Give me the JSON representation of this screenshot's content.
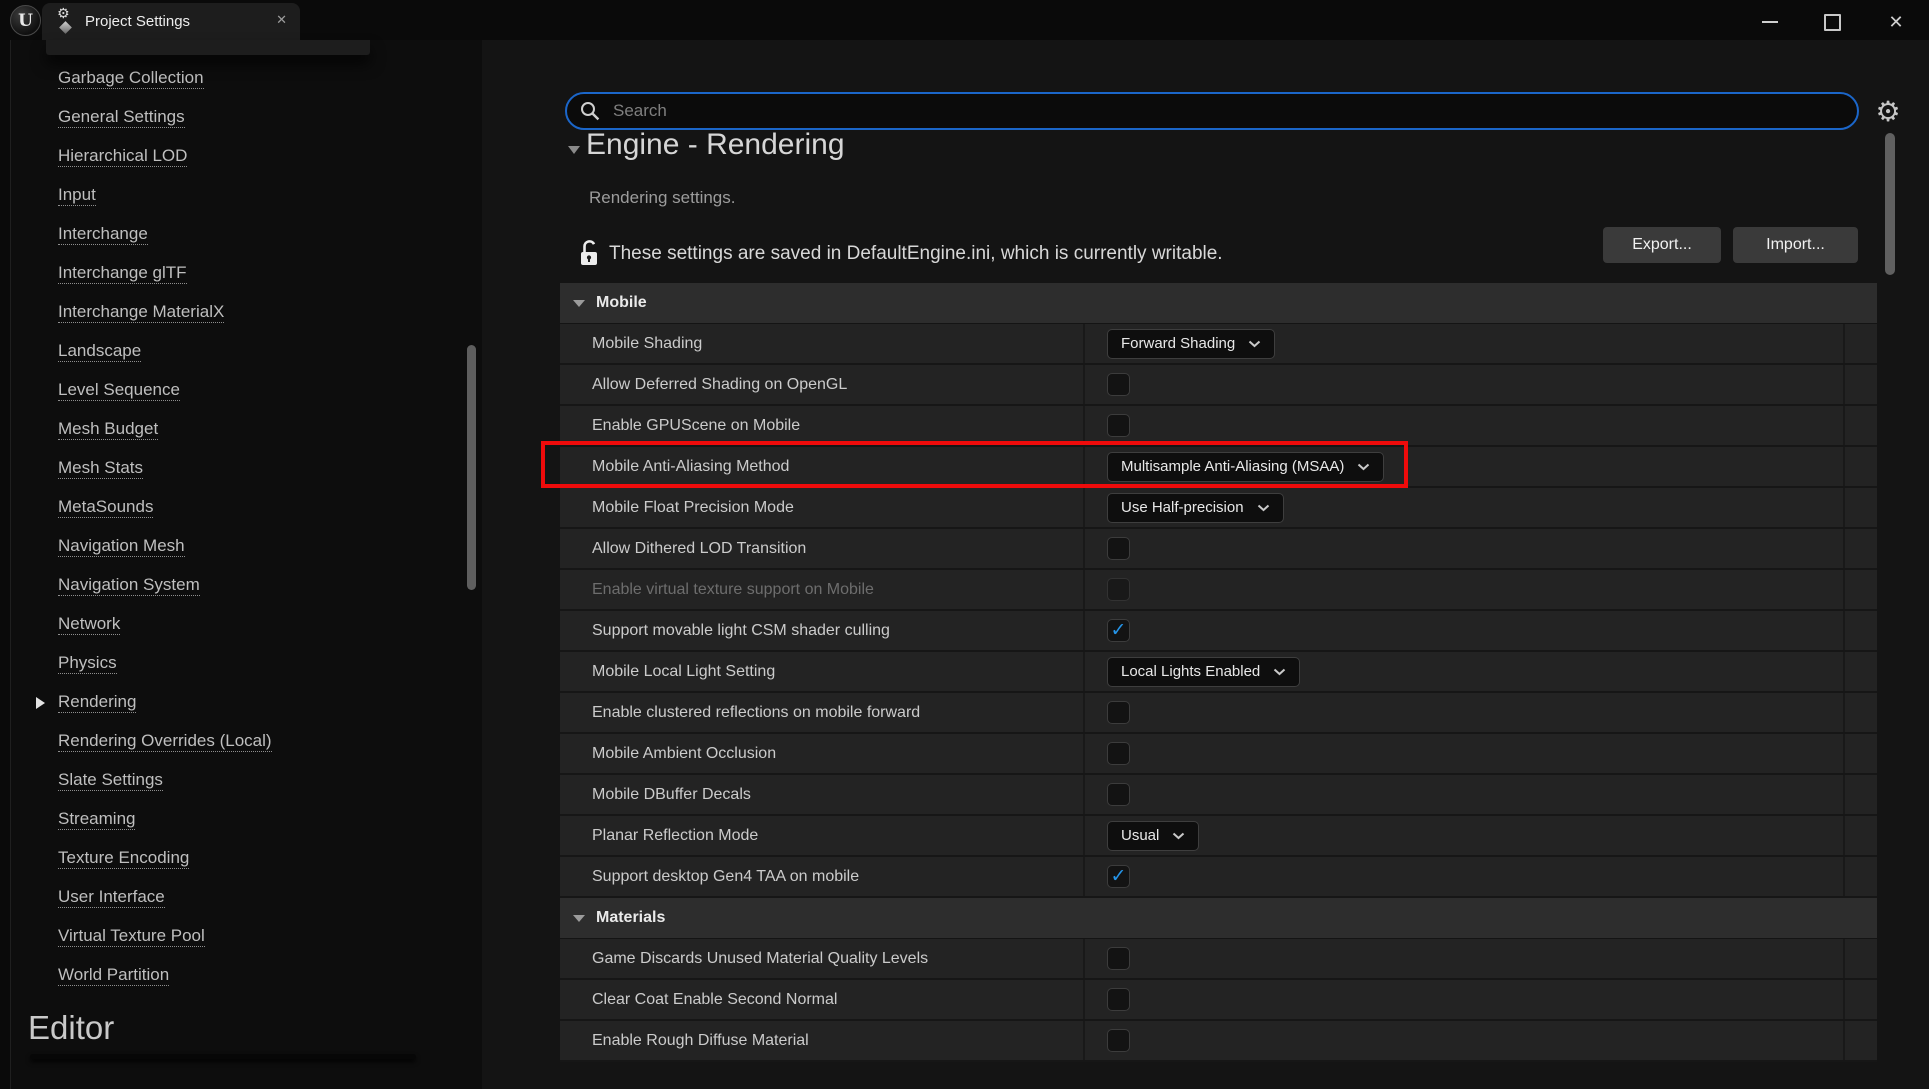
{
  "titlebar": {
    "tab": {
      "label": "Project Settings",
      "close_glyph": "✕"
    },
    "logo_letter": "U",
    "window_controls": {
      "close_glyph": "✕"
    }
  },
  "sidebar": {
    "items": [
      {
        "label": "Garbage Collection"
      },
      {
        "label": "General Settings"
      },
      {
        "label": "Hierarchical LOD"
      },
      {
        "label": "Input"
      },
      {
        "label": "Interchange"
      },
      {
        "label": "Interchange glTF"
      },
      {
        "label": "Interchange MaterialX"
      },
      {
        "label": "Landscape"
      },
      {
        "label": "Level Sequence"
      },
      {
        "label": "Mesh Budget"
      },
      {
        "label": "Mesh Stats"
      },
      {
        "label": "MetaSounds"
      },
      {
        "label": "Navigation Mesh"
      },
      {
        "label": "Navigation System"
      },
      {
        "label": "Network"
      },
      {
        "label": "Physics"
      },
      {
        "label": "Rendering",
        "selected": true
      },
      {
        "label": "Rendering Overrides (Local)"
      },
      {
        "label": "Slate Settings"
      },
      {
        "label": "Streaming"
      },
      {
        "label": "Texture Encoding"
      },
      {
        "label": "User Interface"
      },
      {
        "label": "Virtual Texture Pool"
      },
      {
        "label": "World Partition"
      }
    ],
    "footer_section": "Editor"
  },
  "search": {
    "placeholder": "Search"
  },
  "page": {
    "title": "Engine - Rendering",
    "subtitle": "Rendering settings.",
    "notice": "These settings are saved in DefaultEngine.ini, which is currently writable.",
    "export_button": "Export...",
    "import_button": "Import...",
    "gear_glyph": "⚙"
  },
  "sections": [
    {
      "label": "Mobile",
      "rows": [
        {
          "label": "Mobile Shading",
          "control": "dropdown",
          "value": "Forward Shading"
        },
        {
          "label": "Allow Deferred Shading on OpenGL",
          "control": "checkbox",
          "checked": false
        },
        {
          "label": "Enable GPUScene on Mobile",
          "control": "checkbox",
          "checked": false
        },
        {
          "label": "Mobile Anti-Aliasing Method",
          "control": "dropdown",
          "value": "Multisample Anti-Aliasing (MSAA)",
          "highlighted": true
        },
        {
          "label": "Mobile Float Precision Mode",
          "control": "dropdown",
          "value": "Use Half-precision"
        },
        {
          "label": "Allow Dithered LOD Transition",
          "control": "checkbox",
          "checked": false
        },
        {
          "label": "Enable virtual texture support on Mobile",
          "control": "checkbox",
          "checked": false,
          "disabled": true
        },
        {
          "label": "Support movable light CSM shader culling",
          "control": "checkbox",
          "checked": true
        },
        {
          "label": "Mobile Local Light Setting",
          "control": "dropdown",
          "value": "Local Lights Enabled"
        },
        {
          "label": "Enable clustered reflections on mobile forward",
          "control": "checkbox",
          "checked": false
        },
        {
          "label": "Mobile Ambient Occlusion",
          "control": "checkbox",
          "checked": false
        },
        {
          "label": "Mobile DBuffer Decals",
          "control": "checkbox",
          "checked": false
        },
        {
          "label": "Planar Reflection Mode",
          "control": "dropdown",
          "value": "Usual"
        },
        {
          "label": "Support desktop Gen4 TAA on mobile",
          "control": "checkbox",
          "checked": true
        }
      ]
    },
    {
      "label": "Materials",
      "rows": [
        {
          "label": "Game Discards Unused Material Quality Levels",
          "control": "checkbox",
          "checked": false
        },
        {
          "label": "Clear Coat Enable Second Normal",
          "control": "checkbox",
          "checked": false
        },
        {
          "label": "Enable Rough Diffuse Material",
          "control": "checkbox",
          "checked": false
        }
      ]
    }
  ],
  "colors": {
    "search_focus_border": "#1b66c9",
    "checkbox_check": "#2595e9",
    "highlight_red": "#ef0b0b"
  }
}
